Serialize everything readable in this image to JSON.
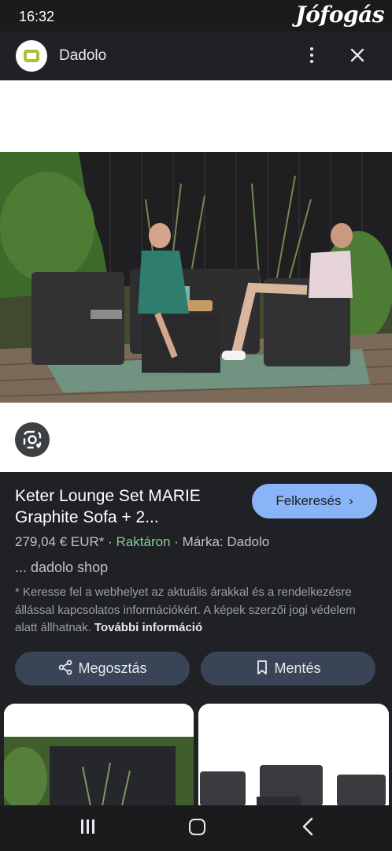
{
  "status_bar": {
    "time": "16:32",
    "watermark": "Jófogás"
  },
  "header": {
    "site_name": "Dadolo",
    "logo_icon": "dadolo-logo",
    "more_icon": "more-vert-icon",
    "close_icon": "close-icon"
  },
  "product": {
    "title": "Keter Lounge Set MARIE Graphite Sofa + 2...",
    "visit_label": "Felkeresés",
    "price": "279,04 € EUR*",
    "separator": "·",
    "stock": "Raktáron",
    "brand": "Márka: Dadolo",
    "shop": "... dadolo shop",
    "disclaimer": "* Keresse fel a webhelyet az aktuális árakkal és a rendelkezésre állással kapcsolatos információkért. A képek szerzői jogi védelem alatt állhatnak.",
    "more_info": "További információ"
  },
  "actions": {
    "share_label": "Megosztás",
    "save_label": "Mentés"
  },
  "colors": {
    "accent": "#8ab4f8",
    "stock_green": "#81c995",
    "background": "#202124",
    "button_bg": "#394457"
  },
  "nav": {
    "recent_icon": "recent-apps-icon",
    "home_icon": "home-icon",
    "back_icon": "back-icon"
  }
}
